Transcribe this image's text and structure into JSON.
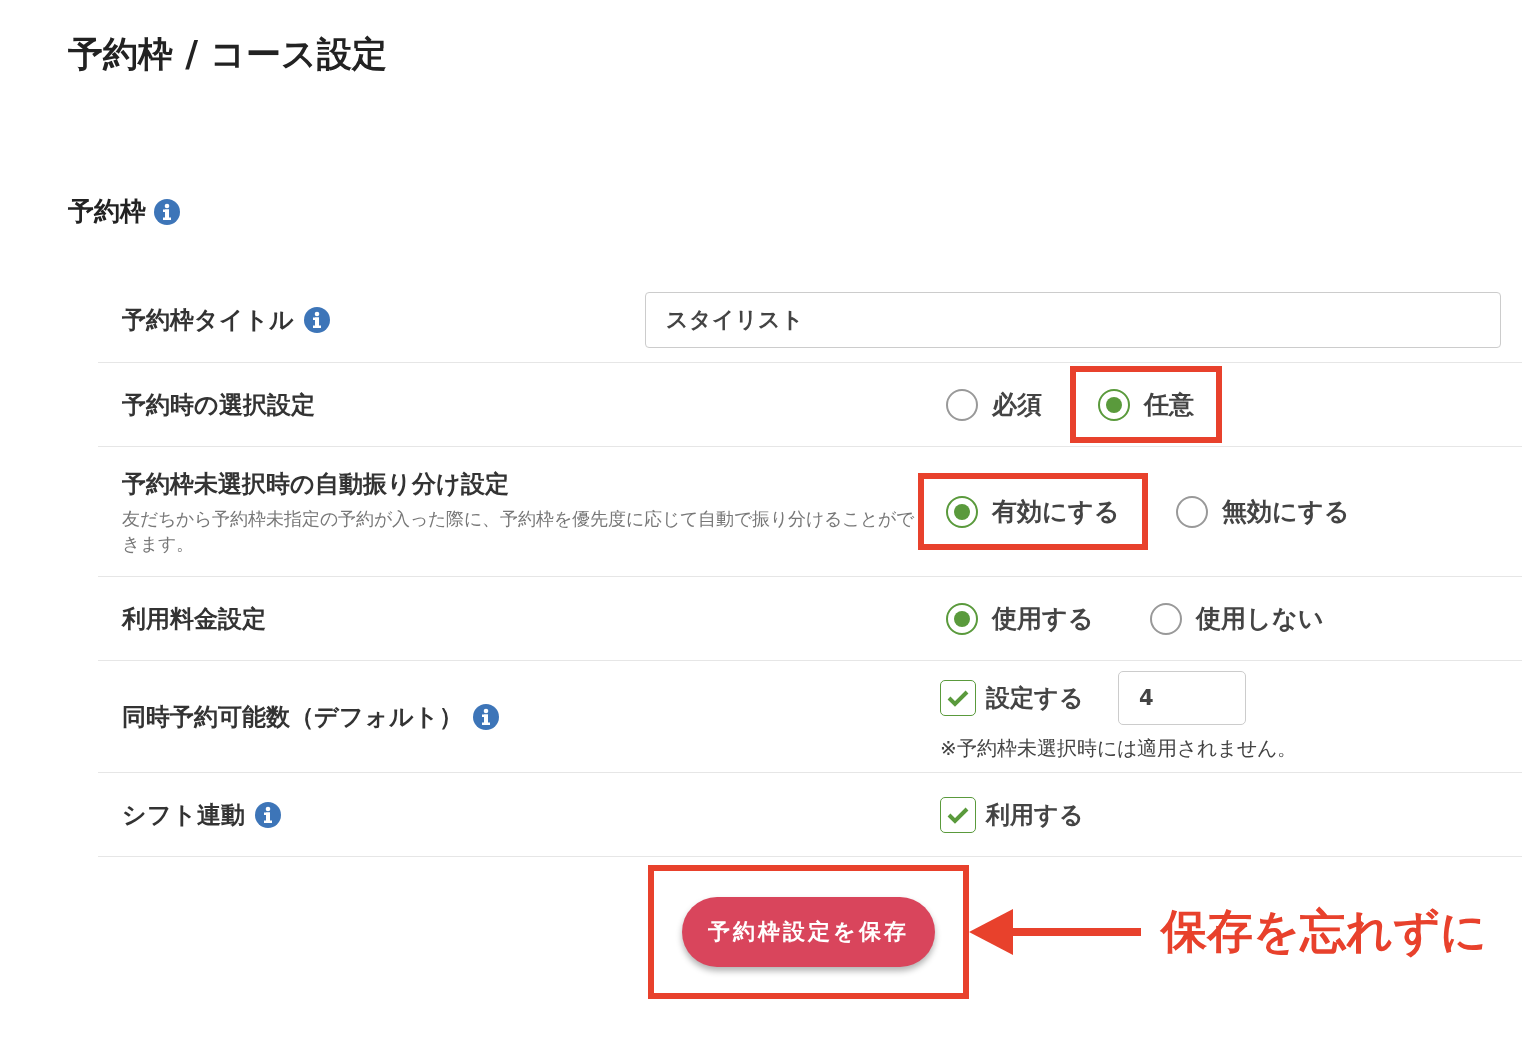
{
  "page_title": "予約枠 / コース設定",
  "section": {
    "title": "予約枠",
    "info": true
  },
  "rows": [
    {
      "kind": "text",
      "label": "予約枠タイトル",
      "info": true,
      "value": "スタイリスト"
    },
    {
      "kind": "radio",
      "label": "予約時の選択設定",
      "info": false,
      "options": [
        {
          "label": "必須",
          "selected": false,
          "highlighted": false
        },
        {
          "label": "任意",
          "selected": true,
          "highlighted": true
        }
      ]
    },
    {
      "kind": "radio",
      "label": "予約枠未選択時の自動振り分け設定",
      "info": false,
      "description": "友だちから予約枠未指定の予約が入った際に、予約枠を優先度に応じて自動で振り分けることができます。",
      "options": [
        {
          "label": "有効にする",
          "selected": true,
          "highlighted": true
        },
        {
          "label": "無効にする",
          "selected": false,
          "highlighted": false
        }
      ]
    },
    {
      "kind": "radio",
      "label": "利用料金設定",
      "info": false,
      "options": [
        {
          "label": "使用する",
          "selected": true,
          "highlighted": false
        },
        {
          "label": "使用しない",
          "selected": false,
          "highlighted": false
        }
      ]
    },
    {
      "kind": "checkbox_number",
      "label": "同時予約可能数（デフォルト）",
      "info": true,
      "check_label": "設定する",
      "checked": true,
      "value": "4",
      "note": "※予約枠未選択時には適用されません。"
    },
    {
      "kind": "checkbox",
      "label": "シフト連動",
      "info": true,
      "check_label": "利用する",
      "checked": true
    }
  ],
  "save_button": {
    "label": "予約枠設定を保存",
    "highlighted": true
  },
  "annotation": {
    "text": "保存を忘れずに"
  }
}
